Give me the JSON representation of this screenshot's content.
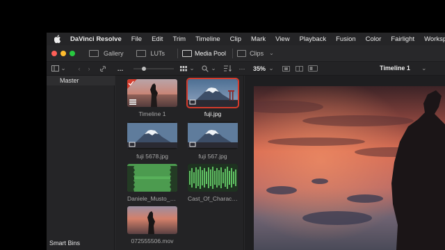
{
  "menubar": {
    "app_name": "DaVinci Resolve",
    "items": [
      "File",
      "Edit",
      "Trim",
      "Timeline",
      "Clip",
      "Mark",
      "View",
      "Playback",
      "Fusion",
      "Color",
      "Fairlight",
      "Workspace"
    ]
  },
  "toolbar": {
    "gallery_label": "Gallery",
    "luts_label": "LUTs",
    "media_pool_label": "Media Pool",
    "clips_label": "Clips"
  },
  "subbar": {
    "zoom": "35%",
    "timeline_name": "Timeline 1"
  },
  "bins": {
    "master_label": "Master",
    "smart_bins_label": "Smart Bins"
  },
  "media": [
    {
      "name": "Timeline 1",
      "kind": "timeline",
      "selected": false
    },
    {
      "name": "fuji.jpg",
      "kind": "image",
      "selected": true
    },
    {
      "name": "fuji 5678.jpg",
      "kind": "image",
      "selected": false
    },
    {
      "name": "fuji 567.jpg",
      "kind": "image",
      "selected": false
    },
    {
      "name": "Daniele_Musto_Lo...",
      "kind": "audio",
      "selected": false
    },
    {
      "name": "Cast_Of_Characte...",
      "kind": "audio",
      "selected": false
    },
    {
      "name": "072555506.mov",
      "kind": "video",
      "selected": false
    }
  ],
  "colors": {
    "accent_red": "#d33b2c",
    "traffic_red": "#ff5f57",
    "traffic_yellow": "#febc2e",
    "traffic_green": "#28c840"
  }
}
